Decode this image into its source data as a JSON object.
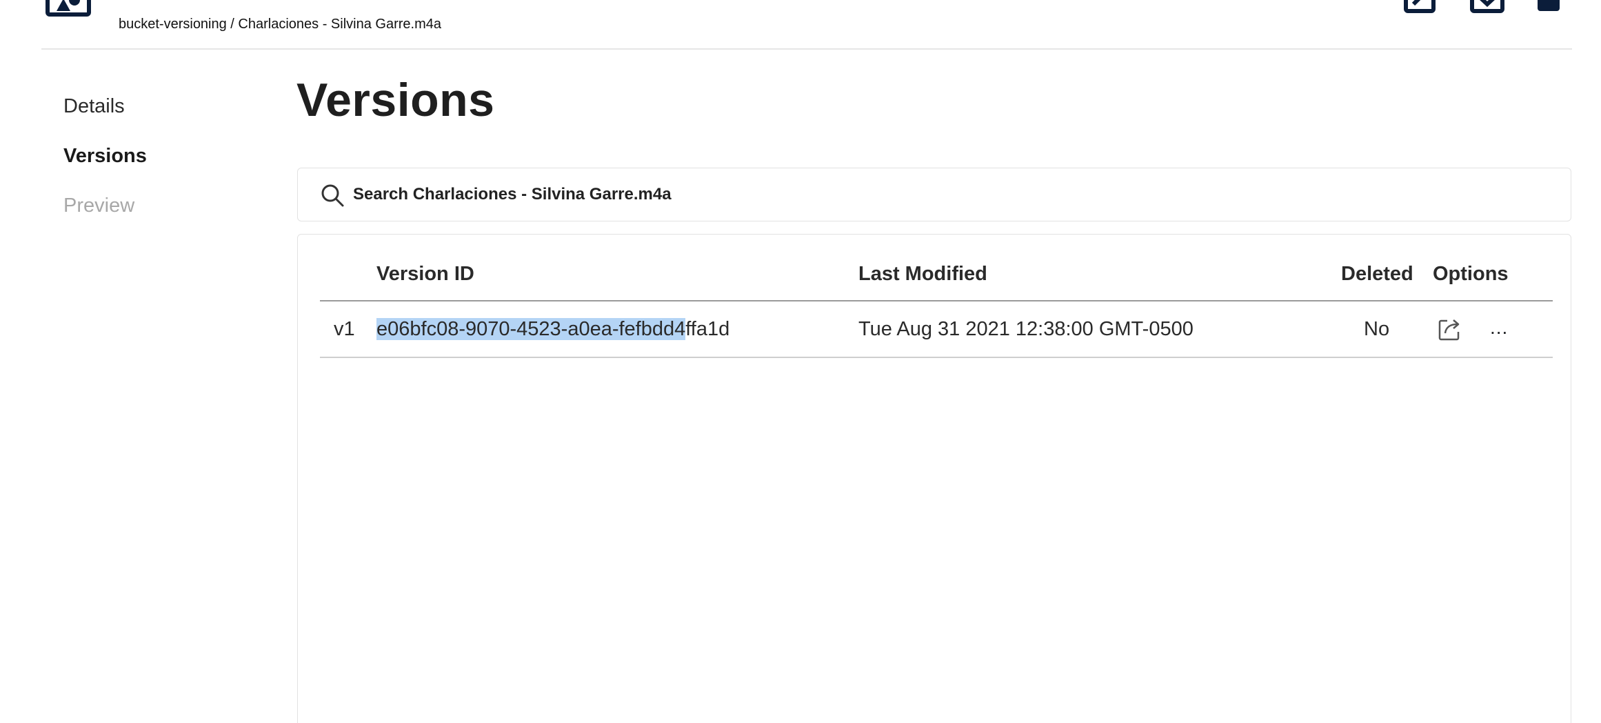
{
  "header": {
    "breadcrumb": "bucket-versioning / Charlaciones - Silvina Garre.m4a",
    "icons": [
      "logo-icon",
      "share-icon",
      "download-icon",
      "delete-icon"
    ]
  },
  "sidebar": {
    "items": [
      {
        "label": "Details",
        "state": "normal"
      },
      {
        "label": "Versions",
        "state": "active"
      },
      {
        "label": "Preview",
        "state": "disabled"
      }
    ]
  },
  "main": {
    "title": "Versions",
    "search": {
      "placeholder": "Search Charlaciones - Silvina Garre.m4a",
      "value": ""
    },
    "table": {
      "columns": [
        "Version ID",
        "Last Modified",
        "Deleted",
        "Options"
      ],
      "rows": [
        {
          "label": "v1",
          "version_id_selected": "e06bfc08-9070-4523-a0ea-fefbdd4",
          "version_id_rest": "ffa1d",
          "last_modified": "Tue Aug 31 2021 12:38:00 GMT-0500",
          "deleted": "No",
          "more": "..."
        }
      ]
    }
  },
  "colors": {
    "brand_navy": "#0b1d3a",
    "selection": "#b4d4f5"
  }
}
